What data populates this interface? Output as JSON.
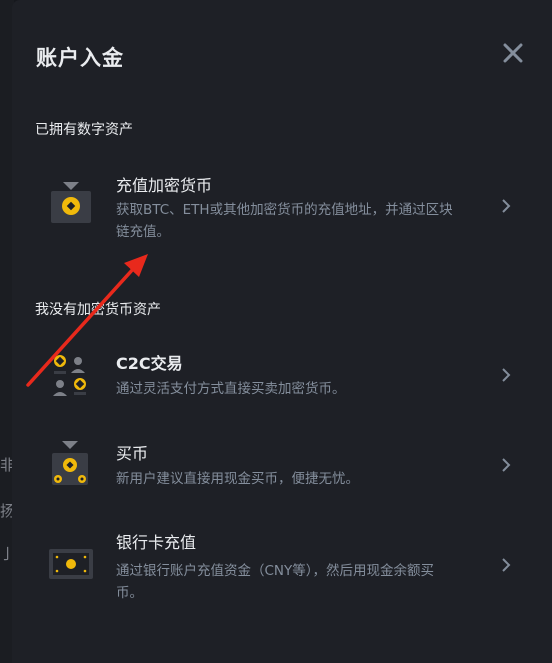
{
  "dialog": {
    "title": "账户入金"
  },
  "sections": [
    {
      "label": "已拥有数字资产"
    },
    {
      "label": "我没有加密货币资产"
    }
  ],
  "items": [
    {
      "name": "充值加密货币",
      "desc": "获取BTC、ETH或其他加密货币的充值地址，并通过区块链充值。",
      "icon": "deposit-crypto-icon"
    },
    {
      "name": "C2C交易",
      "desc": "通过灵活支付方式直接买卖加密货币。",
      "icon": "c2c-trade-icon"
    },
    {
      "name": "买币",
      "desc": "新用户建议直接用现金买币，便捷无忧。",
      "icon": "buy-crypto-icon"
    },
    {
      "name": "银行卡充值",
      "desc": "通过银行账户充值资金（CNY等），然后用现金余额买币。",
      "icon": "bank-card-icon"
    }
  ],
  "background_fragments": [
    "非",
    "扬",
    "亅"
  ],
  "colors": {
    "accent": "#f0b90b",
    "background": "#1e2026",
    "annotation_arrow": "#e8291c"
  }
}
